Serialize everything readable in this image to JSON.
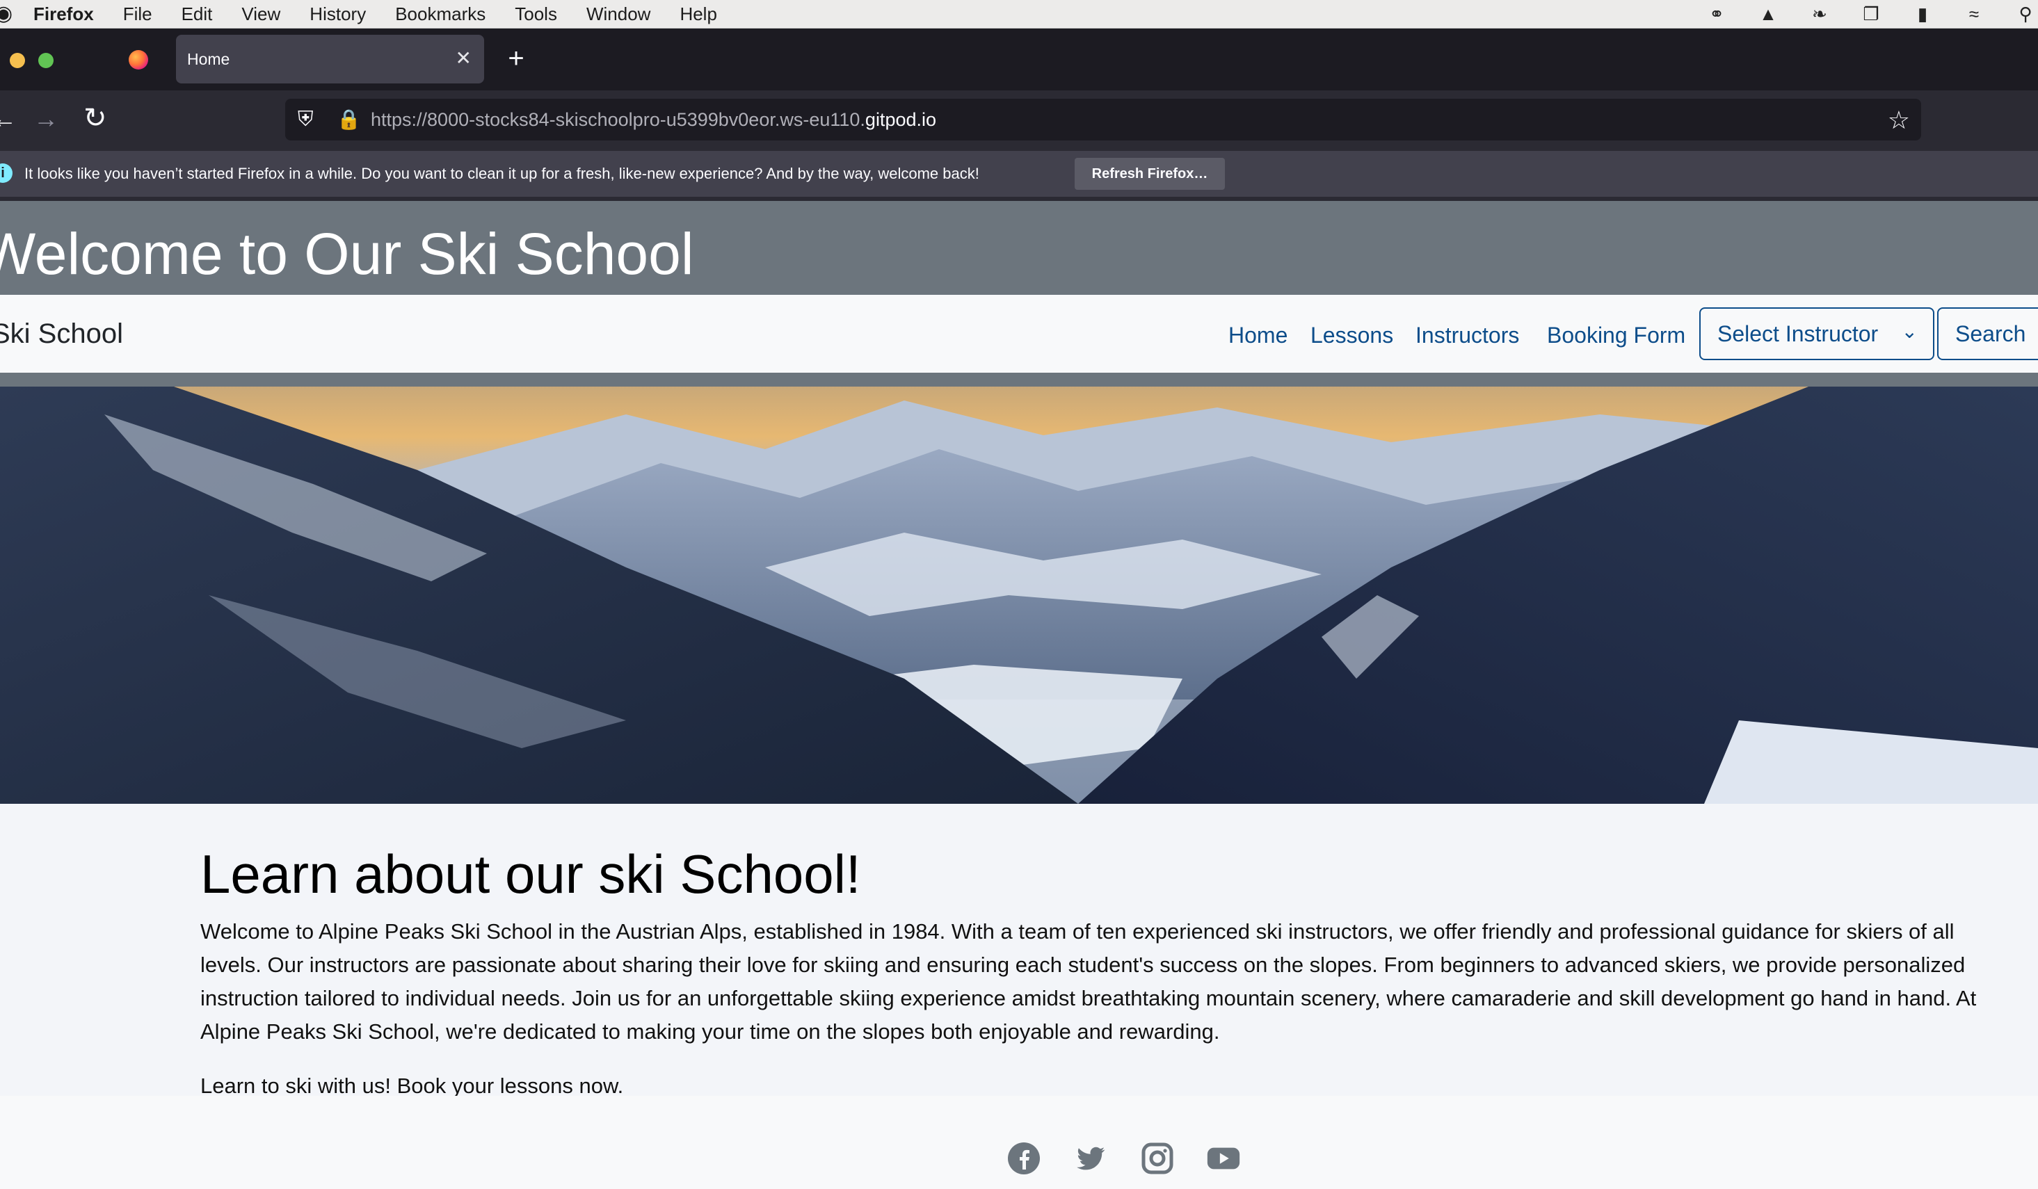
{
  "menubar": {
    "apple": "",
    "items": [
      "Firefox",
      "File",
      "Edit",
      "View",
      "History",
      "Bookmarks",
      "Tools",
      "Window",
      "Help"
    ],
    "status_icons": [
      "creative-cloud-icon",
      "drive-icon",
      "leaf-icon",
      "windows-icon",
      "battery-icon",
      "wifi-icon",
      "search-icon"
    ]
  },
  "browser": {
    "tab_title": "Home",
    "tab_close": "✕",
    "new_tab": "+",
    "url_prefix": "https://8000-stocks84-skischoolpro-u5399bv0eor.ws-eu110.",
    "url_host": "gitpod.io",
    "notification": "It looks like you haven’t started Firefox in a while. Do you want to clean it up for a fresh, like-new experience? And by the way, welcome back!",
    "refresh_button": "Refresh Firefox…"
  },
  "header": {
    "title": "Welcome to Our Ski School"
  },
  "nav": {
    "brand": "Ski School",
    "links": [
      "Home",
      "Lessons",
      "Instructors",
      "Booking Form"
    ],
    "select_label": "Select Instructor",
    "search_label": "Search"
  },
  "main": {
    "heading": "Learn about our ski School!",
    "paragraph": "Welcome to Alpine Peaks Ski School in the Austrian Alps, established in 1984. With a team of ten experienced ski instructors, we offer friendly and professional guidance for skiers of all levels. Our instructors are passionate about sharing their love for skiing and ensuring each student's success on the slopes. From beginners to advanced skiers, we provide personalized instruction tailored to individual needs. Join us for an unforgettable skiing experience amidst breathtaking mountain scenery, where camaraderie and skill development go hand in hand. At Alpine Peaks Ski School, we're dedicated to making your time on the slopes both enjoyable and rewarding.",
    "cta": "Learn to ski with us! Book your lessons now."
  },
  "footer": {
    "social_icons": [
      "facebook-icon",
      "twitter-icon",
      "instagram-icon",
      "youtube-icon"
    ]
  },
  "colors": {
    "header_bg": "#6c757d",
    "link": "#0d4d8a",
    "browser_dark": "#1c1b22"
  }
}
